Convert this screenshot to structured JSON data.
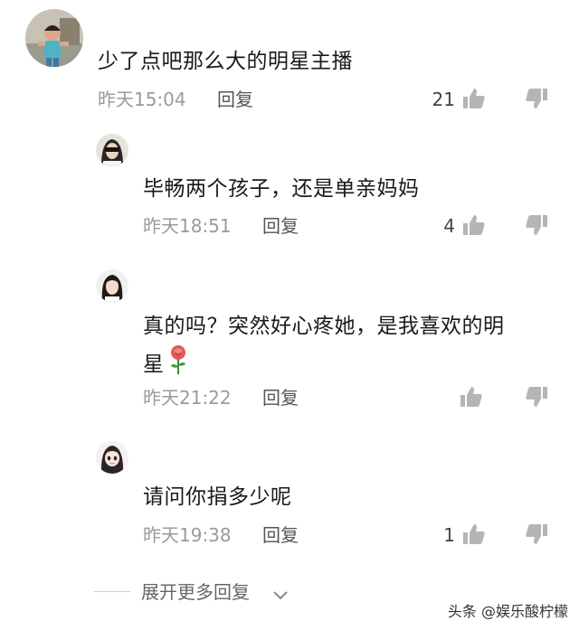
{
  "comments": [
    {
      "text": "少了点吧那么大的明星主播",
      "time": "昨天15:04",
      "reply": "回复",
      "likes": "21",
      "avatar": "child-photo-avatar"
    },
    {
      "text": "毕畅两个孩子，还是单亲妈妈",
      "time": "昨天18:51",
      "reply": "回复",
      "likes": "4",
      "avatar": "woman-sunglasses-avatar"
    },
    {
      "text_line1": "真的吗？突然好心疼她，是我喜欢的明",
      "text_line2": "星",
      "emoji": "rose-emoji",
      "time": "昨天21:22",
      "reply": "回复",
      "likes": "",
      "avatar": "girl-portrait-avatar"
    },
    {
      "text": "请问你捐多少呢",
      "time": "昨天19:38",
      "reply": "回复",
      "likes": "1",
      "avatar": "cartoon-girl-avatar"
    }
  ],
  "expand_label": "展开更多回复",
  "watermark": "头条 @娱乐酸柠檬",
  "icons": {
    "like": "thumbs-up-icon",
    "dislike": "thumbs-down-icon",
    "expand": "chevron-down-icon"
  },
  "colors": {
    "text": "#1a1a1a",
    "meta": "#9a9a9a",
    "icon": "#b5b5b5"
  }
}
